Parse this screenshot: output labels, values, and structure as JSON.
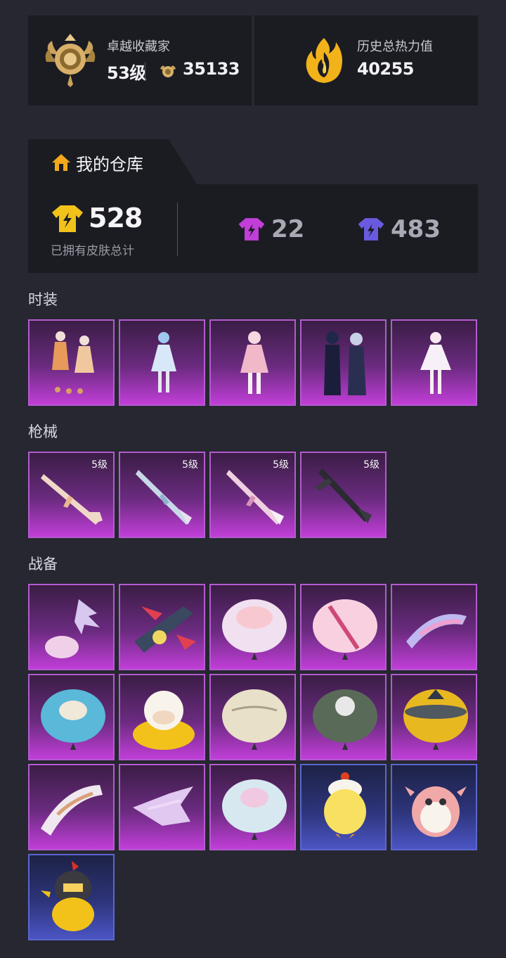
{
  "profile": {
    "title": "卓越收藏家",
    "level": "53级",
    "points": "35133",
    "heat_title": "历史总热力值",
    "heat_value": "40255"
  },
  "warehouse": {
    "tab_label": "我的仓库",
    "total": "528",
    "total_label": "已拥有皮肤总计",
    "legendary_count": "22",
    "epic_count": "483"
  },
  "sections": {
    "outfits": "时装",
    "weapons": "枪械",
    "gear": "战备"
  },
  "weapon_level": "5级",
  "colors": {
    "accent_purple": "#c13ed8",
    "accent_blue": "#4b55c4",
    "gold": "#f2c21a"
  }
}
